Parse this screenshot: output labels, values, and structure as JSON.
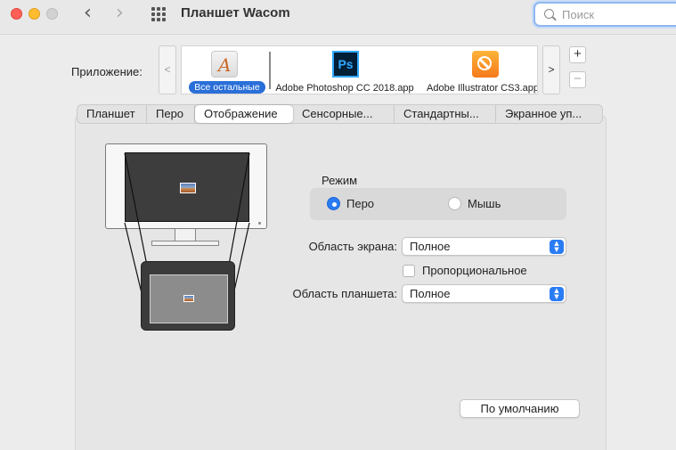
{
  "window": {
    "title": "Планшет Wacom",
    "controls": [
      "close",
      "minimize",
      "zoom"
    ],
    "nav": {
      "back_icon": "chevron-left-icon",
      "forward_icon": "chevron-right-icon",
      "grid_icon": "show-all-grid-icon"
    }
  },
  "search": {
    "placeholder": "Поиск",
    "value": ""
  },
  "apps": {
    "label": "Приложение:",
    "scroll_left": "<",
    "scroll_right": ">",
    "items": [
      {
        "name": "Все остальные",
        "icon": "all-apps-icon",
        "selected": true
      },
      {
        "name": "Adobe Photoshop CC 2018.app",
        "icon": "photoshop-icon",
        "icon_text": "Ps",
        "selected": false
      },
      {
        "name": "Adobe Illustrator CS3.app",
        "icon": "illustrator-icon",
        "selected": false
      }
    ],
    "add_label": "+",
    "remove_label": "−"
  },
  "tabs": [
    {
      "label": "Планшет",
      "active": false
    },
    {
      "label": "Перо",
      "active": false
    },
    {
      "label": "Отображение",
      "active": true
    },
    {
      "label": "Сенсорные...",
      "active": false
    },
    {
      "label": "Стандартны...",
      "active": false
    },
    {
      "label": "Экранное уп...",
      "active": false
    }
  ],
  "mapping": {
    "mode_label": "Режим",
    "mode_options": [
      {
        "label": "Перо",
        "selected": true
      },
      {
        "label": "Мышь",
        "selected": false
      }
    ],
    "screen_area_label": "Область экрана:",
    "screen_area_value": "Полное",
    "proportional_label": "Пропорциональное",
    "proportional_checked": false,
    "tablet_area_label": "Область планшета:",
    "tablet_area_value": "Полное",
    "popup_arrows": "▲▼",
    "default_button": "По умолчанию"
  },
  "colors": {
    "accent": "#2a7cf5",
    "selection": "#2a6fd8",
    "traffic_red": "#fe5f57",
    "traffic_yellow": "#febc2e"
  }
}
